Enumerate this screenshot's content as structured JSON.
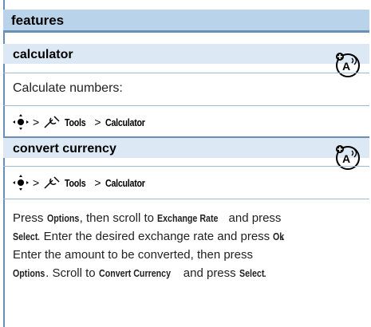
{
  "header": {
    "title": "features"
  },
  "calculator": {
    "title": "calculator",
    "description": "Calculate numbers:",
    "path": {
      "sep1": ">",
      "tools": "Tools",
      "sep2": ">",
      "calc": "Calculator"
    },
    "icon": "network-feature-icon"
  },
  "currency": {
    "title": "convert currency",
    "path": {
      "sep1": ">",
      "tools": "Tools",
      "sep2": ">",
      "calc": "Calculator"
    },
    "icon": "network-feature-icon",
    "p1_a": "Press ",
    "p1_options": "Options",
    "p1_b": ", then scroll to ",
    "p1_exchange": "Exchange Rate",
    "p1_c": " and press",
    "p2_select": "Select",
    "p2_a": ". Enter the desired exchange rate and press ",
    "p2_ok": "Ok",
    "p2_b": ".",
    "p3": "Enter the amount to be converted, then press",
    "p4_options": "Options",
    "p4_a": ". Scroll to ",
    "p4_convert": "Convert Currency",
    "p4_b": " and press ",
    "p4_select": "Select",
    "p4_c": "."
  },
  "colors": {
    "accent": "#6a8fb5",
    "header_bg": "#b9d3ea",
    "section_bg": "#dce9f5"
  }
}
